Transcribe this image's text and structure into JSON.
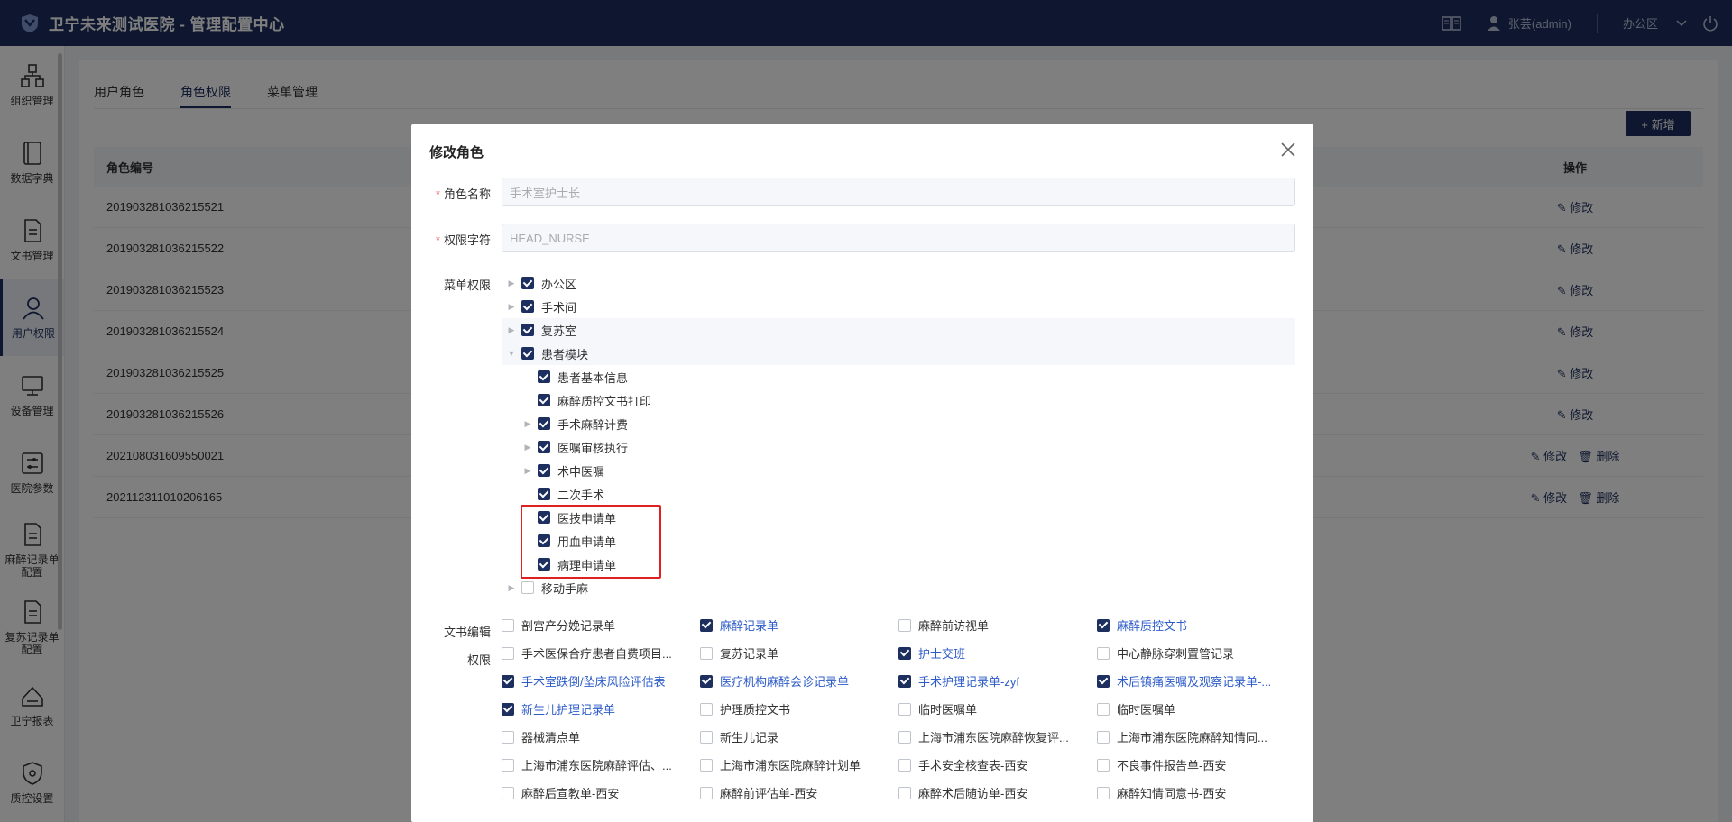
{
  "header": {
    "title": "卫宁未来测试医院 - 管理配置中心",
    "user": "张芸(admin)",
    "area": "办公区"
  },
  "sidebar": {
    "items": [
      {
        "label": "组织管理",
        "icon": "org-icon"
      },
      {
        "label": "数据字典",
        "icon": "book-icon"
      },
      {
        "label": "文书管理",
        "icon": "document-icon"
      },
      {
        "label": "用户权限",
        "icon": "user-icon"
      },
      {
        "label": "设备管理",
        "icon": "monitor-icon"
      },
      {
        "label": "医院参数",
        "icon": "sliders-icon"
      },
      {
        "label": "麻醉记录单配置",
        "icon": "document-icon"
      },
      {
        "label": "复苏记录单配置",
        "icon": "document-icon"
      },
      {
        "label": "卫宁报表",
        "icon": "report-icon"
      },
      {
        "label": "质控设置",
        "icon": "shield-icon"
      }
    ]
  },
  "tabs": [
    "用户角色",
    "角色权限",
    "菜单管理"
  ],
  "toolbar": {
    "add_label": "+ 新增"
  },
  "table": {
    "headers": {
      "id": "角色编号",
      "op": "操作"
    },
    "edit": "修改",
    "delete": "删除",
    "rows": [
      {
        "id": "201903281036215521",
        "deletable": false
      },
      {
        "id": "201903281036215522",
        "deletable": false
      },
      {
        "id": "201903281036215523",
        "deletable": false
      },
      {
        "id": "201903281036215524",
        "deletable": false
      },
      {
        "id": "201903281036215525",
        "deletable": false
      },
      {
        "id": "201903281036215526",
        "deletable": false
      },
      {
        "id": "202108031609550021",
        "deletable": true
      },
      {
        "id": "202112311010206165",
        "deletable": true
      }
    ]
  },
  "dialog": {
    "title": "修改角色",
    "role_name_label": "角色名称",
    "role_name_value": "手术室护士长",
    "perm_char_label": "权限字符",
    "perm_char_value": "HEAD_NURSE",
    "menu_label": "菜单权限",
    "doc_label_1": "文书编辑",
    "doc_label_2": "权限"
  },
  "menu_tree": [
    {
      "label": "办公区",
      "level": 0,
      "arrow": "right",
      "checked": true
    },
    {
      "label": "手术间",
      "level": 0,
      "arrow": "right",
      "checked": true
    },
    {
      "label": "复苏室",
      "level": 0,
      "arrow": "right",
      "checked": true,
      "highlight": true
    },
    {
      "label": "患者模块",
      "level": 0,
      "arrow": "down",
      "checked": true,
      "highlight": true
    },
    {
      "label": "患者基本信息",
      "level": 1,
      "arrow": "none",
      "checked": true
    },
    {
      "label": "麻醉质控文书打印",
      "level": 1,
      "arrow": "none",
      "checked": true
    },
    {
      "label": "手术麻醉计费",
      "level": 1,
      "arrow": "right",
      "checked": true
    },
    {
      "label": "医嘱审核执行",
      "level": 1,
      "arrow": "right",
      "checked": true
    },
    {
      "label": "术中医嘱",
      "level": 1,
      "arrow": "right",
      "checked": true
    },
    {
      "label": "二次手术",
      "level": 1,
      "arrow": "none",
      "checked": true
    },
    {
      "label": "医技申请单",
      "level": 1,
      "arrow": "none",
      "checked": true
    },
    {
      "label": "用血申请单",
      "level": 1,
      "arrow": "none",
      "checked": true
    },
    {
      "label": "病理申请单",
      "level": 1,
      "arrow": "none",
      "checked": true
    },
    {
      "label": "移动手麻",
      "level": 0,
      "arrow": "right",
      "checked": false
    }
  ],
  "doc_items": [
    [
      {
        "label": "剖宫产分娩记录单",
        "checked": false
      },
      {
        "label": "麻醉记录单",
        "checked": true
      },
      {
        "label": "麻醉前访视单",
        "checked": false
      },
      {
        "label": "麻醉质控文书",
        "checked": true
      }
    ],
    [
      {
        "label": "手术医保合疗患者自费项目...",
        "checked": false
      },
      {
        "label": "复苏记录单",
        "checked": false
      },
      {
        "label": "护士交班",
        "checked": true
      },
      {
        "label": "中心静脉穿刺置管记录",
        "checked": false
      }
    ],
    [
      {
        "label": "手术室跌倒/坠床风险评估表",
        "checked": true
      },
      {
        "label": "医疗机构麻醉会诊记录单",
        "checked": true
      },
      {
        "label": "手术护理记录单-zyf",
        "checked": true
      },
      {
        "label": "术后镇痛医嘱及观察记录单-...",
        "checked": true
      }
    ],
    [
      {
        "label": "新生儿护理记录单",
        "checked": true
      },
      {
        "label": "护理质控文书",
        "checked": false
      },
      {
        "label": "临时医嘱单",
        "checked": false
      },
      {
        "label": "临时医嘱单",
        "checked": false
      }
    ],
    [
      {
        "label": "器械清点单",
        "checked": false
      },
      {
        "label": "新生儿记录",
        "checked": false
      },
      {
        "label": "上海市浦东医院麻醉恢复评...",
        "checked": false
      },
      {
        "label": "上海市浦东医院麻醉知情同...",
        "checked": false
      }
    ],
    [
      {
        "label": "上海市浦东医院麻醉评估、...",
        "checked": false
      },
      {
        "label": "上海市浦东医院麻醉计划单",
        "checked": false
      },
      {
        "label": "手术安全核查表-西安",
        "checked": false
      },
      {
        "label": "不良事件报告单-西安",
        "checked": false
      }
    ],
    [
      {
        "label": "麻醉后宣教单-西安",
        "checked": false
      },
      {
        "label": "麻醉前评估单-西安",
        "checked": false
      },
      {
        "label": "麻醉术后随访单-西安",
        "checked": false
      },
      {
        "label": "麻醉知情同意书-西安",
        "checked": false
      }
    ]
  ]
}
